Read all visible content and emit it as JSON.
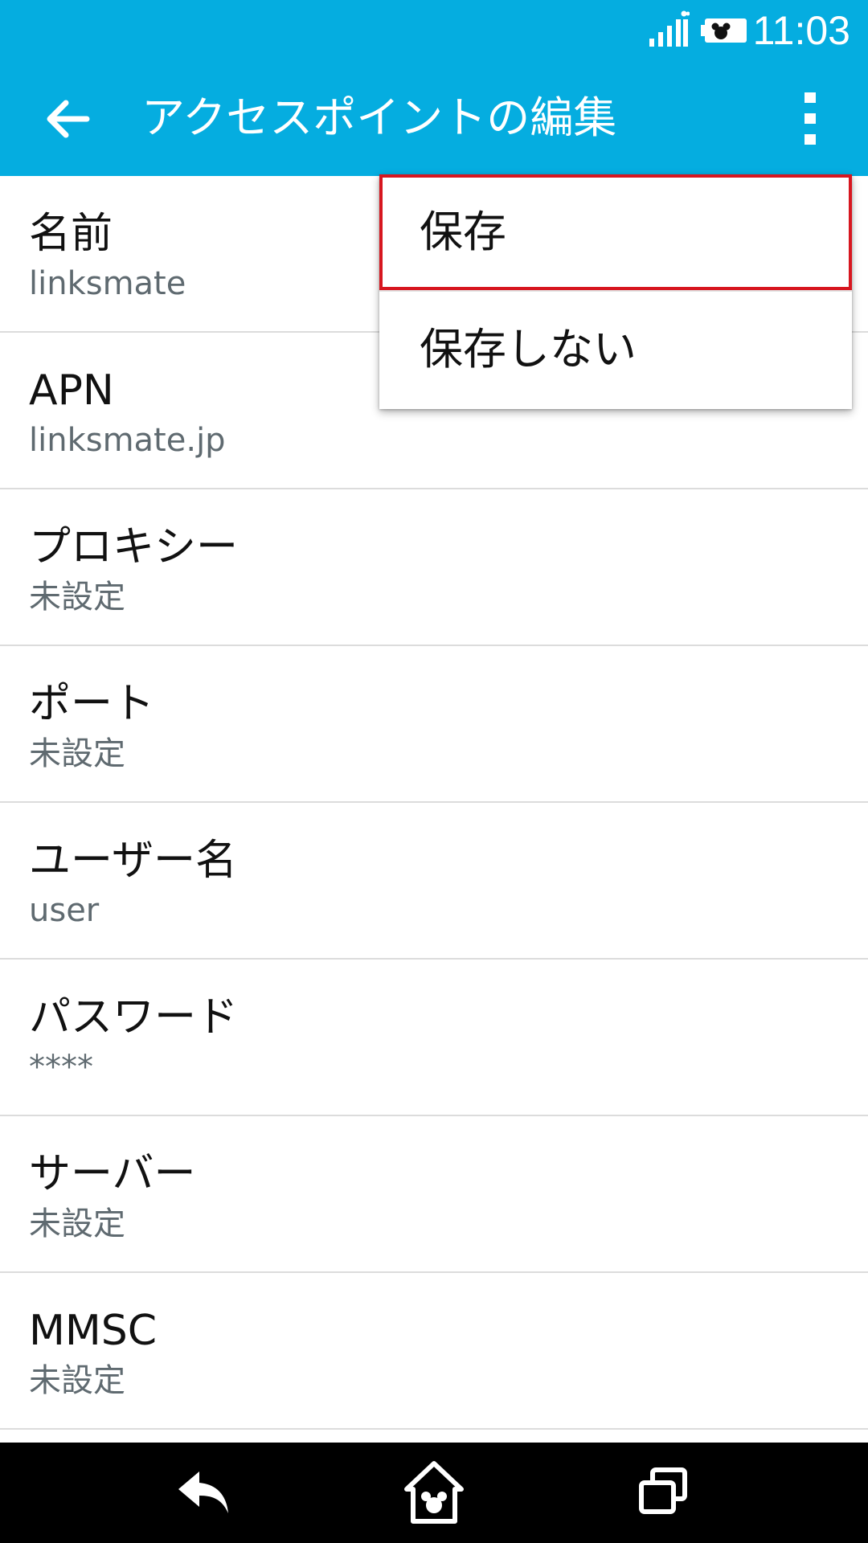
{
  "status_bar": {
    "time": "11:03",
    "icons": [
      "signal-icon",
      "battery-icon"
    ]
  },
  "toolbar": {
    "title": "アクセスポイントの編集",
    "back_icon": "arrow-left-icon",
    "menu_icon": "more-vert-icon"
  },
  "settings": [
    {
      "title": "名前",
      "value": "linksmate"
    },
    {
      "title": "APN",
      "value": "linksmate.jp"
    },
    {
      "title": "プロキシー",
      "value": "未設定"
    },
    {
      "title": "ポート",
      "value": "未設定"
    },
    {
      "title": "ユーザー名",
      "value": "user"
    },
    {
      "title": "パスワード",
      "value": "****"
    },
    {
      "title": "サーバー",
      "value": "未設定"
    },
    {
      "title": "MMSC",
      "value": "未設定"
    }
  ],
  "popup_menu": {
    "items": [
      {
        "label": "保存",
        "highlighted": true
      },
      {
        "label": "保存しない",
        "highlighted": false
      }
    ],
    "highlight_color": "#d7161f"
  },
  "nav_bar": {
    "icons": [
      "back-icon",
      "home-icon",
      "recents-icon"
    ]
  },
  "colors": {
    "primary": "#05ade0",
    "text_primary": "#111111",
    "text_secondary": "#5f6a70",
    "divider": "#dcdcdc",
    "nav_bar": "#000000"
  }
}
